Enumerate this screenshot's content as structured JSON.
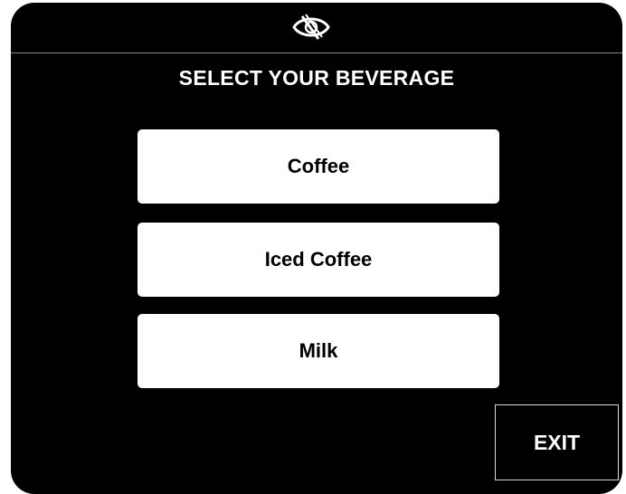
{
  "header": {
    "logo_icon": "eye-slash-icon"
  },
  "title": "SELECT YOUR BEVERAGE",
  "beverages": [
    {
      "label": "Coffee"
    },
    {
      "label": "Iced Coffee"
    },
    {
      "label": "Milk"
    }
  ],
  "exit_label": "EXIT",
  "colors": {
    "background": "#000000",
    "button": "#ffffff",
    "button_text": "#000000",
    "text": "#ffffff",
    "divider": "#8a8a8a"
  }
}
